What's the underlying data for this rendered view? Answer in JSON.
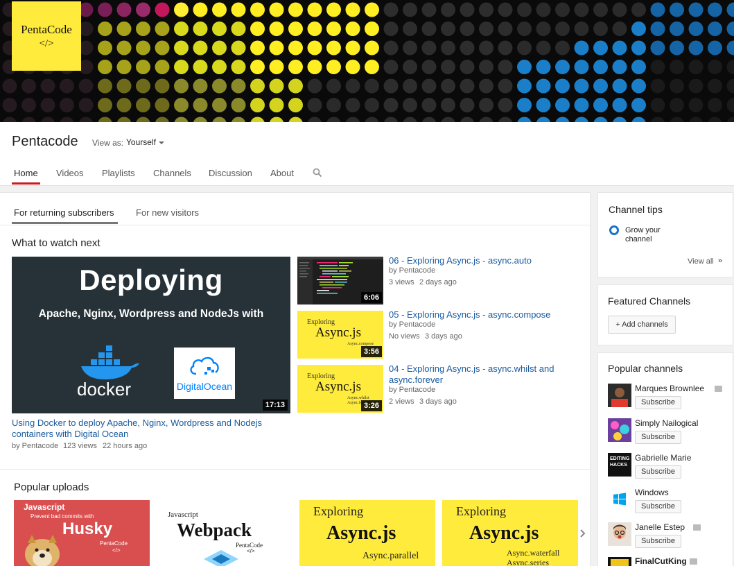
{
  "banner": {
    "logo_line1": "PentaCode",
    "logo_line2": "</>"
  },
  "channel": {
    "name": "Pentacode",
    "view_as_label": "View as:",
    "view_as_value": "Yourself"
  },
  "nav": {
    "tabs": [
      "Home",
      "Videos",
      "Playlists",
      "Channels",
      "Discussion",
      "About"
    ],
    "active": "Home"
  },
  "main": {
    "subtabs": [
      "For returning subscribers",
      "For new visitors"
    ],
    "section_watch_next": "What to watch next",
    "featured": {
      "thumb_heading": "Deploying",
      "thumb_subheading": "Apache, Nginx, Wordpress and NodeJs with",
      "thumb_docker": "docker",
      "thumb_do": "DigitalOcean",
      "duration": "17:13",
      "title": "Using Docker to deploy Apache, Nginx, Wordpress and Nodejs containers with Digital Ocean",
      "by": "by Pentacode",
      "views": "123 views",
      "age": "22 hours ago"
    },
    "side_videos": [
      {
        "title": "06 - Exploring Async.js - async.auto",
        "by": "by Pentacode",
        "views": "3 views",
        "age": "2 days ago",
        "duration": "6:06"
      },
      {
        "title": "05 - Exploring Async.js - async.compose",
        "by": "by Pentacode",
        "views": "No views",
        "age": "3 days ago",
        "duration": "3:56",
        "thumb_explore": "Exploring",
        "thumb_async": "Async.js",
        "thumb_sub": "Async.compose"
      },
      {
        "title": "04 - Exploring Async.js - async.whilst and async.forever",
        "by": "by Pentacode",
        "views": "2 views",
        "age": "3 days ago",
        "duration": "3:26",
        "thumb_explore": "Exploring",
        "thumb_async": "Async.js",
        "thumb_sub": "Async.whilst",
        "thumb_sub2": "Async.forever"
      }
    ],
    "section_popular": "Popular uploads",
    "popular": [
      {
        "top": "Javascript",
        "sub": "Prevent bad commits with",
        "big": "Husky",
        "brand": "PentaCode",
        "code": "</>"
      },
      {
        "top": "Javascript",
        "big": "Webpack",
        "brand": "PentaCode",
        "code": "</>"
      },
      {
        "explore": "Exploring",
        "big": "Async.js",
        "sub": "Async.parallel"
      },
      {
        "explore": "Exploring",
        "big": "Async.js",
        "sub": "Async.waterfall",
        "sub2": "Async.series"
      }
    ]
  },
  "right": {
    "tips_title": "Channel tips",
    "tip_text": "Grow your channel",
    "view_all": "View all",
    "view_all_arrow": "»",
    "featured_title": "Featured Channels",
    "add_channels": "+ Add channels",
    "popular_title": "Popular channels",
    "subscribe_label": "Subscribe",
    "channels": [
      {
        "name": "Marques Brownlee",
        "verified": true
      },
      {
        "name": "Simply Nailogical",
        "verified": false
      },
      {
        "name": "Gabrielle Marie",
        "verified": false,
        "avatar_text": "EDITING HACKS"
      },
      {
        "name": "Windows",
        "verified": false
      },
      {
        "name": "Janelle Estep",
        "verified": true
      },
      {
        "name": "FinalCutKing",
        "verified": true
      }
    ]
  },
  "colors": {
    "link": "#1a5a9e",
    "accent_red": "#cc181e",
    "logo_yellow": "#ffeb3b",
    "windows_blue": "#00a4ef"
  }
}
